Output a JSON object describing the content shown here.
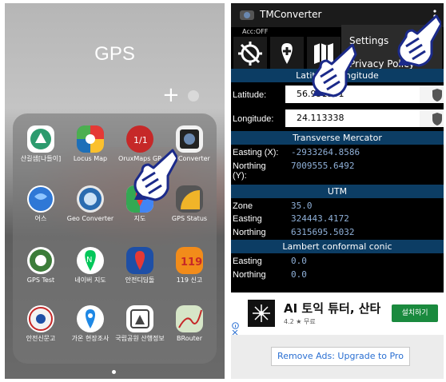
{
  "left_screen": {
    "folder_title": "GPS",
    "add_symbol": "+",
    "apps": [
      {
        "label": "산길샘[나들이]",
        "icon": "trail-map-icon",
        "color": "#2c9b6e"
      },
      {
        "label": "Locus Map",
        "icon": "locus-map-icon",
        "color": "#1d6fb8"
      },
      {
        "label": "OruxMaps GP",
        "icon": "oruxmaps-icon",
        "color": "#c62828"
      },
      {
        "label": "TMConverter",
        "icon": "tmconverter-icon",
        "color": "#222222"
      },
      {
        "label": "어스",
        "icon": "earth-icon",
        "color": "#2f78d6"
      },
      {
        "label": "Geo Converter",
        "icon": "geo-converter-icon",
        "color": "#e8e8e8"
      },
      {
        "label": "지도",
        "icon": "maps-icon",
        "color": "#ffffff"
      },
      {
        "label": "GPS Status",
        "icon": "gps-status-icon",
        "color": "#555555"
      },
      {
        "label": "GPS Test",
        "icon": "gps-test-icon",
        "color": "#3c7d3a"
      },
      {
        "label": "네이버 지도",
        "icon": "naver-map-icon",
        "color": "#ffffff"
      },
      {
        "label": "안전디딤돌",
        "icon": "safety-stone-icon",
        "color": "#1e4fa6"
      },
      {
        "label": "119 신고",
        "icon": "emergency-119-icon",
        "color": "#f28c1a"
      },
      {
        "label": "안전신문고",
        "icon": "safety-report-icon",
        "color": "#ffffff"
      },
      {
        "label": "가온 현장조사",
        "icon": "gaon-survey-icon",
        "color": "#ffffff"
      },
      {
        "label": "국립공원 산행정보",
        "icon": "national-park-icon",
        "color": "#ffffff"
      },
      {
        "label": "BRouter",
        "icon": "brouter-icon",
        "color": "#d6e6c8"
      }
    ]
  },
  "right_screen": {
    "app_title": "TMConverter",
    "acc_status": "Acc:OFF",
    "menu": {
      "items": [
        "Settings",
        "Privacy Policy"
      ]
    },
    "latlon_header": "Latitude/Longitude",
    "latitude_label": "Latitude:",
    "latitude_value": "56.951501",
    "longitude_label": "Longitude:",
    "longitude_value": "24.113338",
    "tm_header": "Transverse Mercator",
    "tm_easting_label": "Easting (X):",
    "tm_easting_value": "-2933264.8586",
    "tm_northing_label": "Northing (Y):",
    "tm_northing_value": "7009555.6492",
    "utm_header": "UTM",
    "utm_zone_label": "Zone",
    "utm_zone_value": "35.0",
    "utm_easting_label": "Easting",
    "utm_easting_value": "324443.4172",
    "utm_northing_label": "Northing",
    "utm_northing_value": "6315695.5032",
    "lcc_header": "Lambert conformal conic",
    "lcc_easting_label": "Easting",
    "lcc_easting_value": "0.0",
    "lcc_northing_label": "Northing",
    "lcc_northing_value": "0.0",
    "ad": {
      "title": "AI 토익 튜터, 산타",
      "rating": "4.2 ★  무료",
      "install_label": "설치하기"
    },
    "remove_ads_label": "Remove Ads: Upgrade to Pro"
  },
  "colors": {
    "section_bar": "#0c3d64",
    "value_text": "#8fb0d8",
    "install_green": "#1a8a3e"
  }
}
